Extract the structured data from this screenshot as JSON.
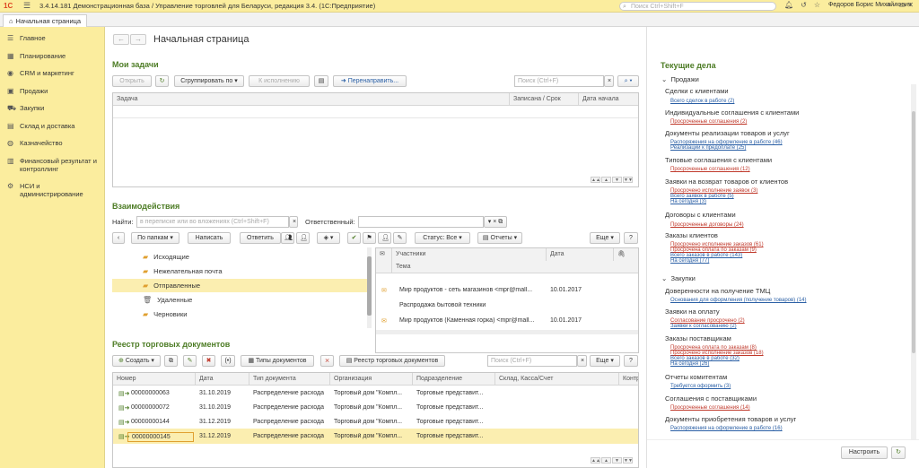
{
  "topbar": {
    "logo": "1С",
    "title": "3.4.14.181 Демонстрационная база / Управление торговлей для Беларуси, редакция 3.4.  (1С:Предприятие)",
    "search_placeholder": "Поиск Ctrl+Shift+F",
    "user": "Федоров Борис Михайлович"
  },
  "tabline": {
    "home_label": "Начальная страница"
  },
  "sidebar": {
    "items": [
      {
        "label": "Главное",
        "icon": "menu-icon"
      },
      {
        "label": "Планирование",
        "icon": "calendar-icon"
      },
      {
        "label": "CRM и маркетинг",
        "icon": "crm-icon"
      },
      {
        "label": "Продажи",
        "icon": "briefcase-icon"
      },
      {
        "label": "Закупки",
        "icon": "cart-icon"
      },
      {
        "label": "Склад и доставка",
        "icon": "warehouse-icon"
      },
      {
        "label": "Казначейство",
        "icon": "treasury-icon"
      },
      {
        "label": "Финансовый результат и контроллинг",
        "icon": "chart-icon"
      },
      {
        "label": "НСИ и администрирование",
        "icon": "settings-icon"
      }
    ]
  },
  "main": {
    "title": "Начальная страница",
    "tasks": {
      "title": "Мои задачи",
      "open_btn": "Открыть",
      "group_btn": "Сгруппировать по",
      "exec_btn": "К исполнению",
      "redirect_btn": "Перенаправить...",
      "search_placeholder": "Поиск (Ctrl+F)",
      "columns": [
        "Задача",
        "Записана / Срок",
        "Дата начала"
      ]
    },
    "interactions": {
      "title": "Взаимодействия",
      "find_label": "Найти:",
      "find_placeholder": "в переписке или во вложениях (Ctrl+Shift+F)",
      "responsible_label": "Ответственный:",
      "folders_btn": "По папкам",
      "write_btn": "Написать",
      "reply_btn": "Ответить",
      "status_btn": "Статус: Все",
      "reports_btn": "Отчеты",
      "more_btn": "Еще",
      "help_btn": "?",
      "folders": [
        "Исходящие",
        "Нежелательная почта",
        "Отправленные",
        "Удаленные",
        "Черновики"
      ],
      "columns": [
        "Участники",
        "Дата",
        "Тема"
      ],
      "rows": [
        {
          "participants": "Мир продуктов - сеть магазинов <mpr@mall...",
          "date": "10.01.2017",
          "subject": "Распродажа бытовой техники"
        },
        {
          "participants": "Мир продуктов (Каменная горка) <mpr@mall...",
          "date": "10.01.2017",
          "subject": ""
        }
      ]
    },
    "registry": {
      "title": "Реестр торговых документов",
      "create_btn": "Создать",
      "doc_types_btn": "Типы документов",
      "registry_btn": "Реестр торговых документов",
      "search_placeholder": "Поиск (Ctrl+F)",
      "more_btn": "Еще",
      "help_btn": "?",
      "columns": [
        "Номер",
        "Дата",
        "Тип документа",
        "Организация",
        "Подразделение",
        "Склад, Касса/Счет",
        "Контр"
      ],
      "rows": [
        {
          "num": "00000000063",
          "date": "31.10.2019",
          "type": "Распределение расхода",
          "org": "Торговый дом \"Компл...",
          "dept": "Торговые представит...",
          "stock": ""
        },
        {
          "num": "00000000072",
          "date": "31.10.2019",
          "type": "Распределение расхода",
          "org": "Торговый дом \"Компл...",
          "dept": "Торговые представит...",
          "stock": ""
        },
        {
          "num": "00000000144",
          "date": "31.12.2019",
          "type": "Распределение расхода",
          "org": "Торговый дом \"Компл...",
          "dept": "Торговые представит...",
          "stock": ""
        },
        {
          "num": "00000000145",
          "date": "31.12.2019",
          "type": "Распределение расхода",
          "org": "Торговый дом \"Компл...",
          "dept": "Торговые представит...",
          "stock": ""
        }
      ]
    }
  },
  "current": {
    "title": "Текущие дела",
    "sales_group": "Продажи",
    "purchases_group": "Закупки",
    "settings_btn": "Настроить",
    "sales": [
      {
        "head": "Сделки с клиентами",
        "links": [
          {
            "text": "Всего сделок в работе (2)",
            "color": "blue"
          }
        ]
      },
      {
        "head": "Индивидуальные соглашения с клиентами",
        "links": [
          {
            "text": "Просроченные соглашения (2)",
            "color": "red"
          }
        ]
      },
      {
        "head": "Документы реализации товаров и услуг",
        "links": [
          {
            "text": "Распоряжения на оформление в работе (46)",
            "color": "blue"
          },
          {
            "text": "Реализации к предоплате (25)",
            "color": "blue"
          }
        ]
      },
      {
        "head": "Типовые соглашения с клиентами",
        "links": [
          {
            "text": "Просроченные соглашения (12)",
            "color": "red"
          }
        ]
      },
      {
        "head": "Заявки на возврат товаров от клиентов",
        "links": [
          {
            "text": "Просрочено исполнение заявок (3)",
            "color": "red"
          },
          {
            "text": "Всего заявок в работе (5)",
            "color": "blue"
          },
          {
            "text": "На сегодня (3)",
            "color": "blue"
          }
        ]
      },
      {
        "head": "Договоры с клиентами",
        "links": [
          {
            "text": "Просроченные договоры (24)",
            "color": "red"
          }
        ]
      },
      {
        "head": "Заказы клиентов",
        "links": [
          {
            "text": "Просрочено исполнение заказов (61)",
            "color": "red"
          },
          {
            "text": "Просрочена оплата по заказам (9)",
            "color": "red"
          },
          {
            "text": "Всего заказов в работе (143)",
            "color": "blue"
          },
          {
            "text": "На сегодня (77)",
            "color": "blue"
          }
        ]
      }
    ],
    "purchases": [
      {
        "head": "Доверенности на получение ТМЦ",
        "links": [
          {
            "text": "Основания для оформления (получение товаров) (14)",
            "color": "blue"
          }
        ]
      },
      {
        "head": "Заявки на оплату",
        "links": [
          {
            "text": "Согласование просрочено (2)",
            "color": "red"
          },
          {
            "text": "Заявки к согласованию (2)",
            "color": "blue"
          }
        ]
      },
      {
        "head": "Заказы поставщикам",
        "links": [
          {
            "text": "Просрочена оплата по заказам (8)",
            "color": "red"
          },
          {
            "text": "Просрочено исполнение заказов (18)",
            "color": "red"
          },
          {
            "text": "Всего заказов в работе (32)",
            "color": "blue"
          },
          {
            "text": "На сегодня (26)",
            "color": "blue"
          }
        ]
      },
      {
        "head": "Отчеты комитентам",
        "links": [
          {
            "text": "Требуется оформить (3)",
            "color": "blue"
          }
        ]
      },
      {
        "head": "Соглашения с поставщиками",
        "links": [
          {
            "text": "Просроченные соглашения (14)",
            "color": "red"
          }
        ]
      },
      {
        "head": "Документы приобретения товаров и услуг",
        "links": [
          {
            "text": "Распоряжения на оформление в работе (16)",
            "color": "blue"
          }
        ]
      }
    ]
  }
}
